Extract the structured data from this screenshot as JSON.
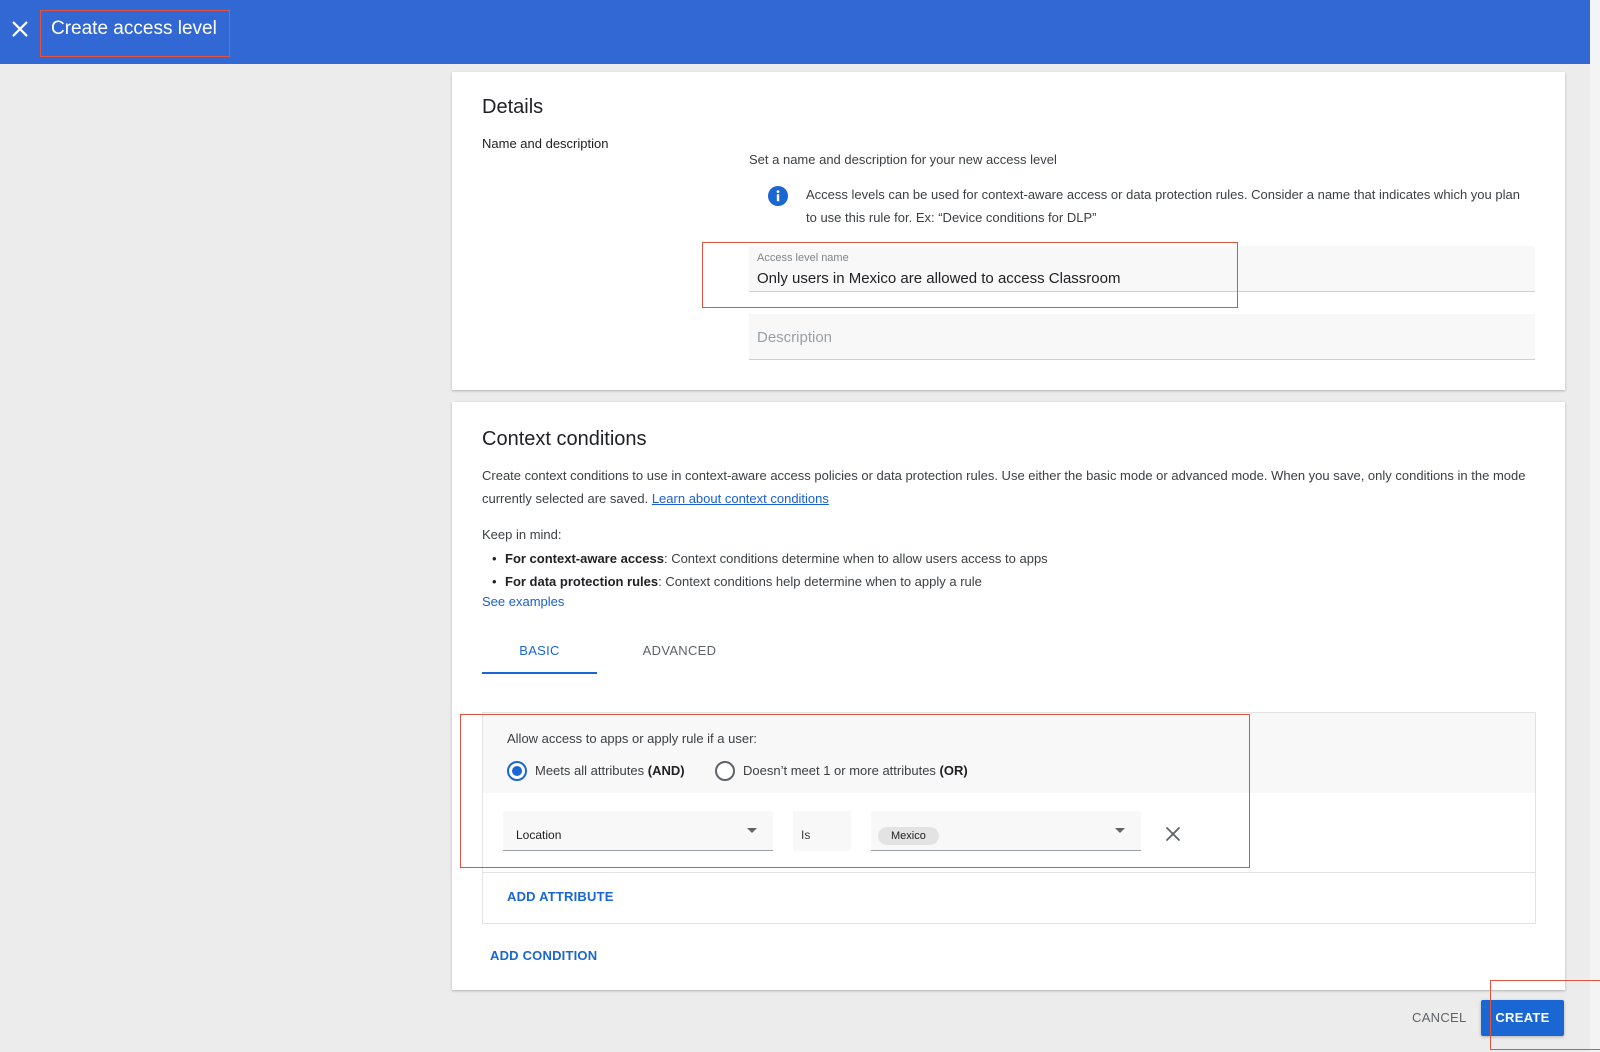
{
  "header": {
    "title": "Create access level",
    "close_icon": "close-icon",
    "background": "#3268d4"
  },
  "details": {
    "heading": "Details",
    "section_label": "Name and description",
    "helper": "Set a name and description for your new access level",
    "info_icon": "info-icon",
    "info_text": "Access levels can be used for context-aware access or data protection rules. Consider a name that indicates which you plan to use this rule for. Ex: “Device conditions for DLP”",
    "name_field": {
      "label": "Access level name",
      "value": "Only users in Mexico are allowed to access Classroom"
    },
    "description_field": {
      "placeholder": "Description",
      "value": ""
    }
  },
  "context": {
    "heading": "Context conditions",
    "description": "Create context conditions to use in context-aware access policies or data protection rules. Use either the basic mode or advanced mode. When you save, only conditions in the mode currently selected are saved.",
    "learn_link": "Learn about context conditions",
    "keep_in_mind": "Keep in mind:",
    "bullets": [
      {
        "bold": "For context-aware access",
        "text": ": Context conditions determine when to allow users access to apps"
      },
      {
        "bold": "For data protection rules",
        "text": ": Context conditions help determine when to apply a rule"
      }
    ],
    "see_examples": "See examples",
    "tabs": [
      {
        "label": "BASIC",
        "active": true
      },
      {
        "label": "ADVANCED",
        "active": false
      }
    ],
    "condition": {
      "allow_text": "Allow access to apps or apply rule if a user:",
      "options": [
        {
          "label": "Meets all attributes",
          "suffix": "(AND)",
          "selected": true
        },
        {
          "label": "Doesn’t meet 1 or more attributes",
          "suffix": "(OR)",
          "selected": false
        }
      ],
      "attribute": {
        "attribute": "Location",
        "operator": "Is",
        "value_chip": "Mexico"
      },
      "add_attribute": "ADD ATTRIBUTE"
    },
    "add_condition": "ADD CONDITION"
  },
  "actions": {
    "cancel": "CANCEL",
    "create": "CREATE"
  },
  "colors": {
    "accent": "#1a66d2",
    "annotation": "#e0533e"
  }
}
